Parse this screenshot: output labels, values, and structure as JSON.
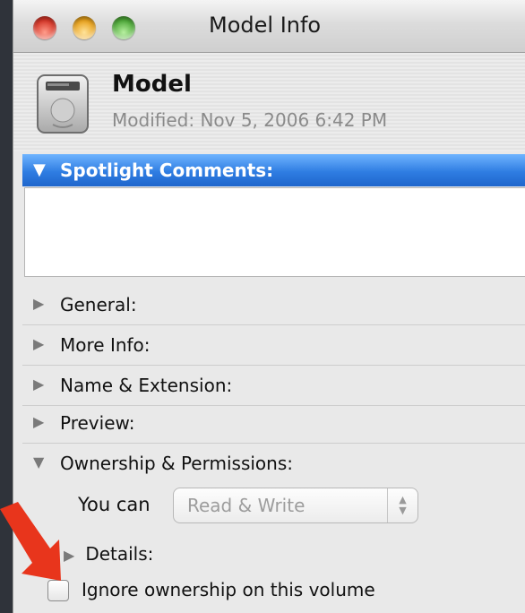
{
  "window": {
    "title": "Model Info"
  },
  "file": {
    "name": "Model",
    "modified": "Modified: Nov 5, 2006 6:42 PM",
    "icon": "hard-disk-icon"
  },
  "spotlight": {
    "label": "Spotlight Comments:",
    "comment": ""
  },
  "sections": {
    "general": "General:",
    "more_info": "More Info:",
    "name_extension": "Name & Extension:",
    "preview": "Preview:",
    "ownership": "Ownership & Permissions:"
  },
  "ownership": {
    "you_can_label": "You can",
    "access_value": "Read & Write",
    "details_label": "Details:",
    "ignore_label": "Ignore ownership on this volume",
    "ignore_checked": false
  },
  "colors": {
    "selection_blue": "#2f7de2",
    "annotation_arrow": "#e8351c"
  }
}
